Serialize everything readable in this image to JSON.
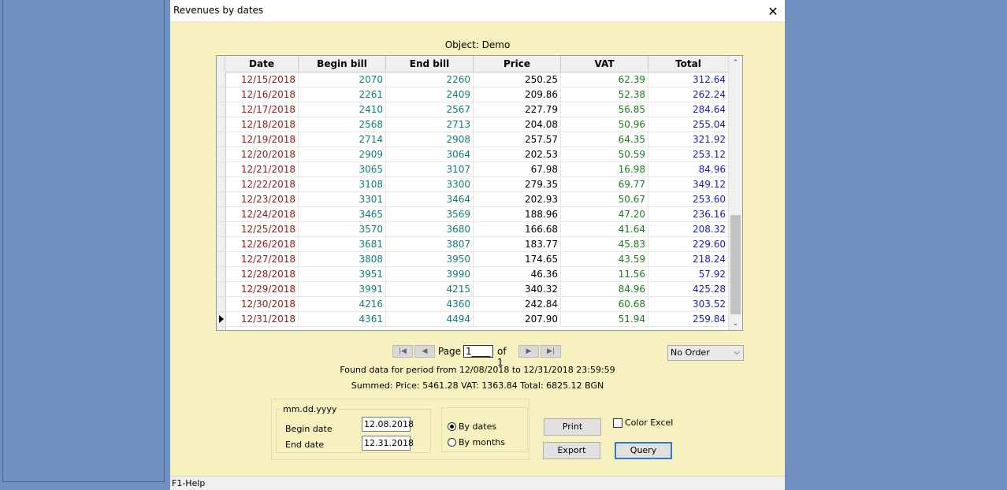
{
  "window": {
    "title": "Revenues by dates"
  },
  "object_label": "Object: Demo",
  "grid": {
    "columns": [
      "Date",
      "Begin bill",
      "End bill",
      "Price",
      "VAT",
      "Total"
    ],
    "rows": [
      [
        "12/15/2018",
        "2070",
        "2260",
        "250.25",
        "62.39",
        "312.64"
      ],
      [
        "12/16/2018",
        "2261",
        "2409",
        "209.86",
        "52.38",
        "262.24"
      ],
      [
        "12/17/2018",
        "2410",
        "2567",
        "227.79",
        "56.85",
        "284.64"
      ],
      [
        "12/18/2018",
        "2568",
        "2713",
        "204.08",
        "50.96",
        "255.04"
      ],
      [
        "12/19/2018",
        "2714",
        "2908",
        "257.57",
        "64.35",
        "321.92"
      ],
      [
        "12/20/2018",
        "2909",
        "3064",
        "202.53",
        "50.59",
        "253.12"
      ],
      [
        "12/21/2018",
        "3065",
        "3107",
        "67.98",
        "16.98",
        "84.96"
      ],
      [
        "12/22/2018",
        "3108",
        "3300",
        "279.35",
        "69.77",
        "349.12"
      ],
      [
        "12/23/2018",
        "3301",
        "3464",
        "202.93",
        "50.67",
        "253.60"
      ],
      [
        "12/24/2018",
        "3465",
        "3569",
        "188.96",
        "47.20",
        "236.16"
      ],
      [
        "12/25/2018",
        "3570",
        "3680",
        "166.68",
        "41.64",
        "208.32"
      ],
      [
        "12/26/2018",
        "3681",
        "3807",
        "183.77",
        "45.83",
        "229.60"
      ],
      [
        "12/27/2018",
        "3808",
        "3950",
        "174.65",
        "43.59",
        "218.24"
      ],
      [
        "12/28/2018",
        "3951",
        "3990",
        "46.36",
        "11.56",
        "57.92"
      ],
      [
        "12/29/2018",
        "3991",
        "4215",
        "340.32",
        "84.96",
        "425.28"
      ],
      [
        "12/30/2018",
        "4216",
        "4360",
        "242.84",
        "60.68",
        "303.52"
      ],
      [
        "12/31/2018",
        "4361",
        "4494",
        "207.90",
        "51.94",
        "259.84"
      ]
    ],
    "selected_row_index": 16
  },
  "pager": {
    "page_label": "Page",
    "page_value": "1____",
    "of_label": "of 1"
  },
  "order_select": {
    "value": "No Order"
  },
  "info": {
    "period": "Found data for period from 12/08/2018  to 12/31/2018 23:59:59",
    "summed": "Summed:  Price: 5461.28   VAT: 1363.84  Total: 6825.12 BGN"
  },
  "date_panel": {
    "format_label": "mm.dd.yyyy",
    "begin_label": "Begin date",
    "begin_value": "12.08.2018",
    "end_label": "End date",
    "end_value": "12.31.2018"
  },
  "radios": {
    "by_dates": "By dates",
    "by_months": "By months",
    "selected": "by_dates"
  },
  "buttons": {
    "print": "Print",
    "export": "Export",
    "query": "Query"
  },
  "color_excel": {
    "label": "Color Excel",
    "checked": false
  },
  "statusbar": {
    "text": "F1-Help"
  }
}
